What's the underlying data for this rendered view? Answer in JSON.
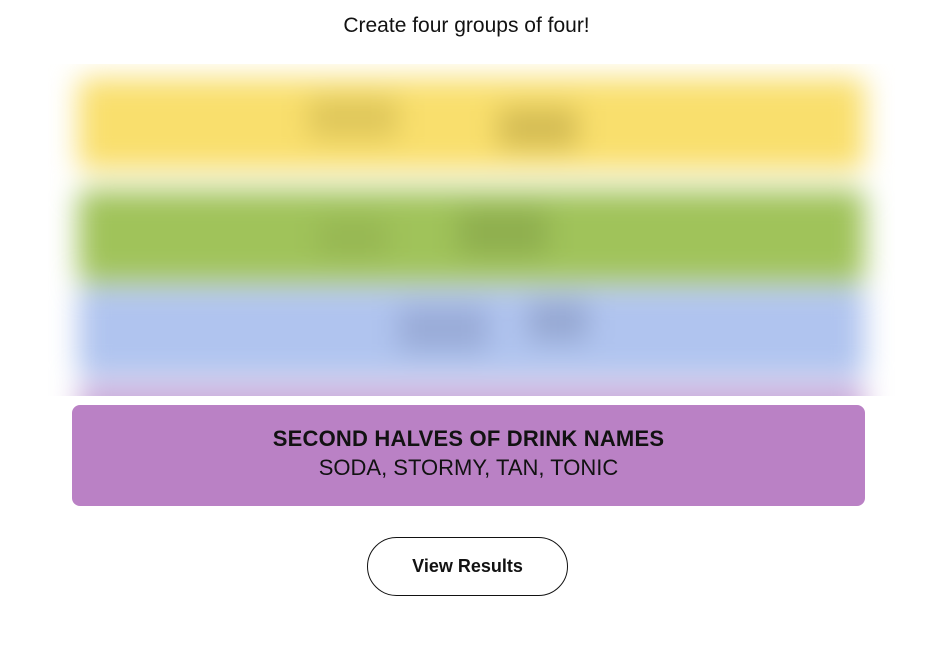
{
  "instructions": "Create four groups of four!",
  "hidden_groups": [
    {
      "color": "#f9df6d"
    },
    {
      "color": "#a0c35a"
    },
    {
      "color": "#b0c4ef"
    }
  ],
  "solved_group": {
    "title": "SECOND HALVES OF DRINK NAMES",
    "members": "SODA, STORMY, TAN, TONIC",
    "color": "#ba81c5"
  },
  "view_results_label": "View Results"
}
